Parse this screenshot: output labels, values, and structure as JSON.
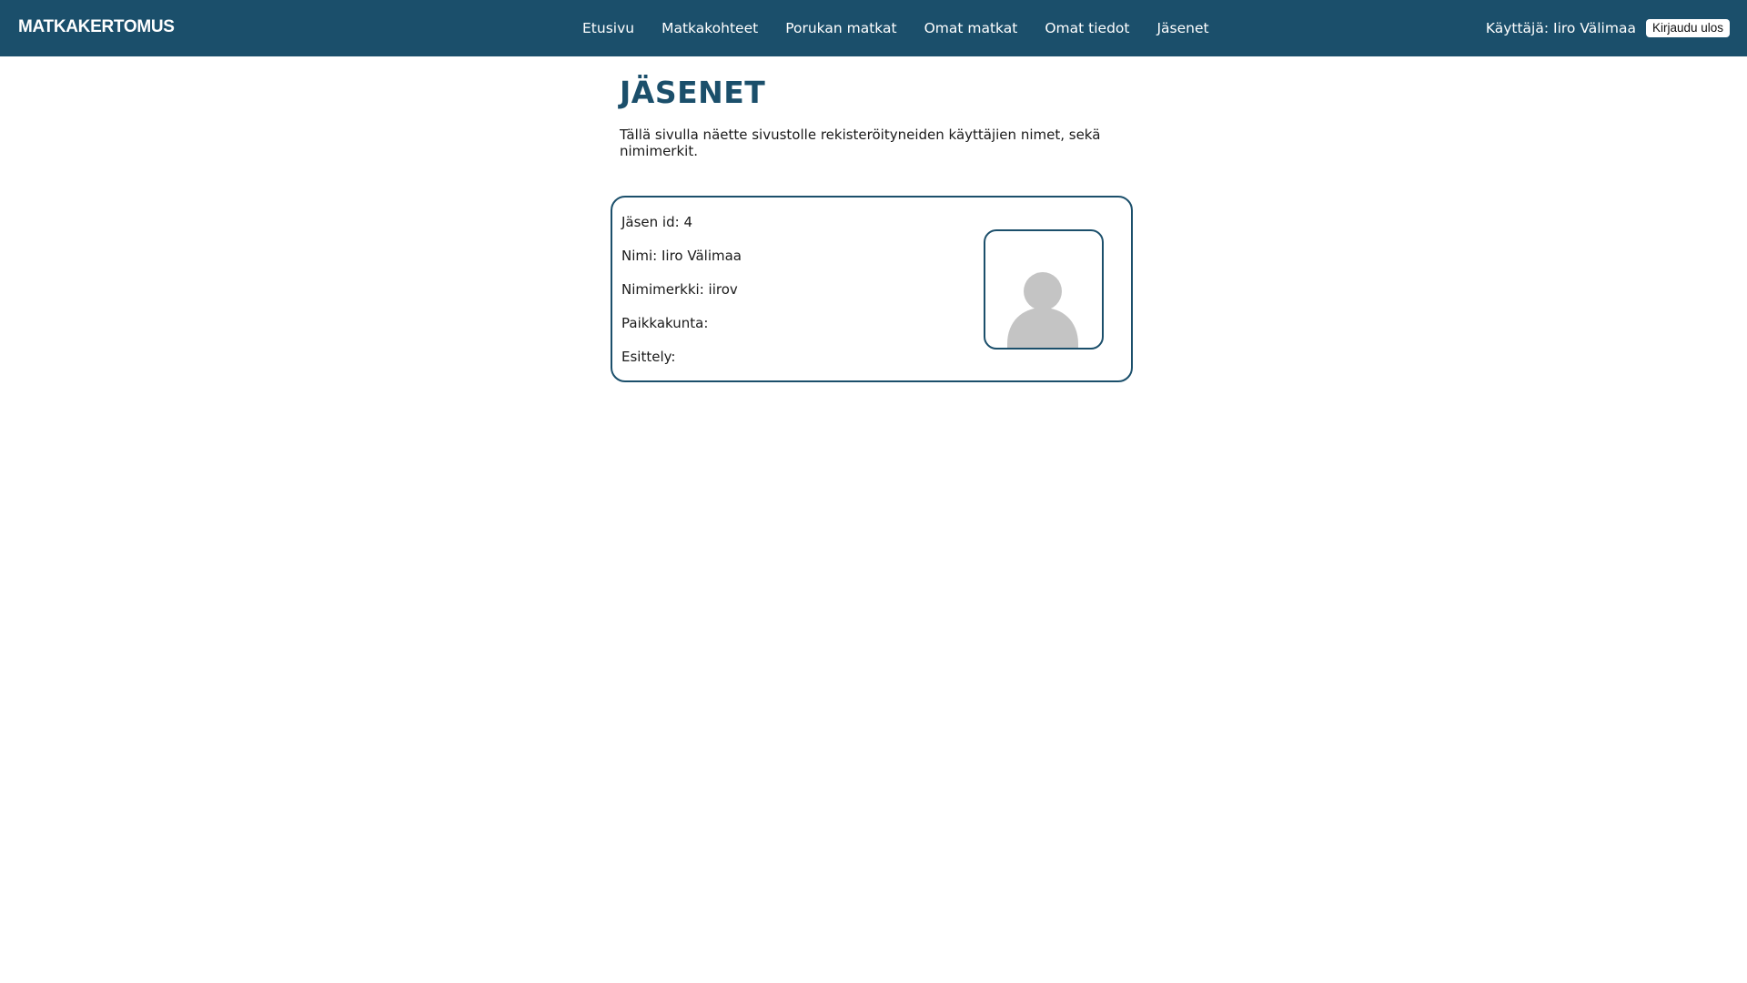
{
  "header": {
    "brand": "MATKAKERTOMUS",
    "nav": [
      {
        "label": "Etusivu"
      },
      {
        "label": "Matkakohteet"
      },
      {
        "label": "Porukan matkat"
      },
      {
        "label": "Omat matkat"
      },
      {
        "label": "Omat tiedot"
      },
      {
        "label": "Jäsenet"
      }
    ],
    "user_text": "Käyttäjä: Iiro Välimaa",
    "logout_label": "Kirjaudu ulos"
  },
  "main": {
    "title": "JÄSENET",
    "intro": "Tällä sivulla näette sivustolle rekisteröityneiden käyttäjien nimet, sekä nimimerkit."
  },
  "member": {
    "id_text": "Jäsen id: 4",
    "name_text": "Nimi: Iiro Välimaa",
    "nickname_text": "Nimimerkki: iirov",
    "city_text": "Paikkakunta:",
    "intro_text": "Esittely:",
    "avatar_icon": "default-user-avatar-icon"
  },
  "colors": {
    "brand": "#1b4f6b",
    "avatar_placeholder": "#c4c4c4"
  }
}
